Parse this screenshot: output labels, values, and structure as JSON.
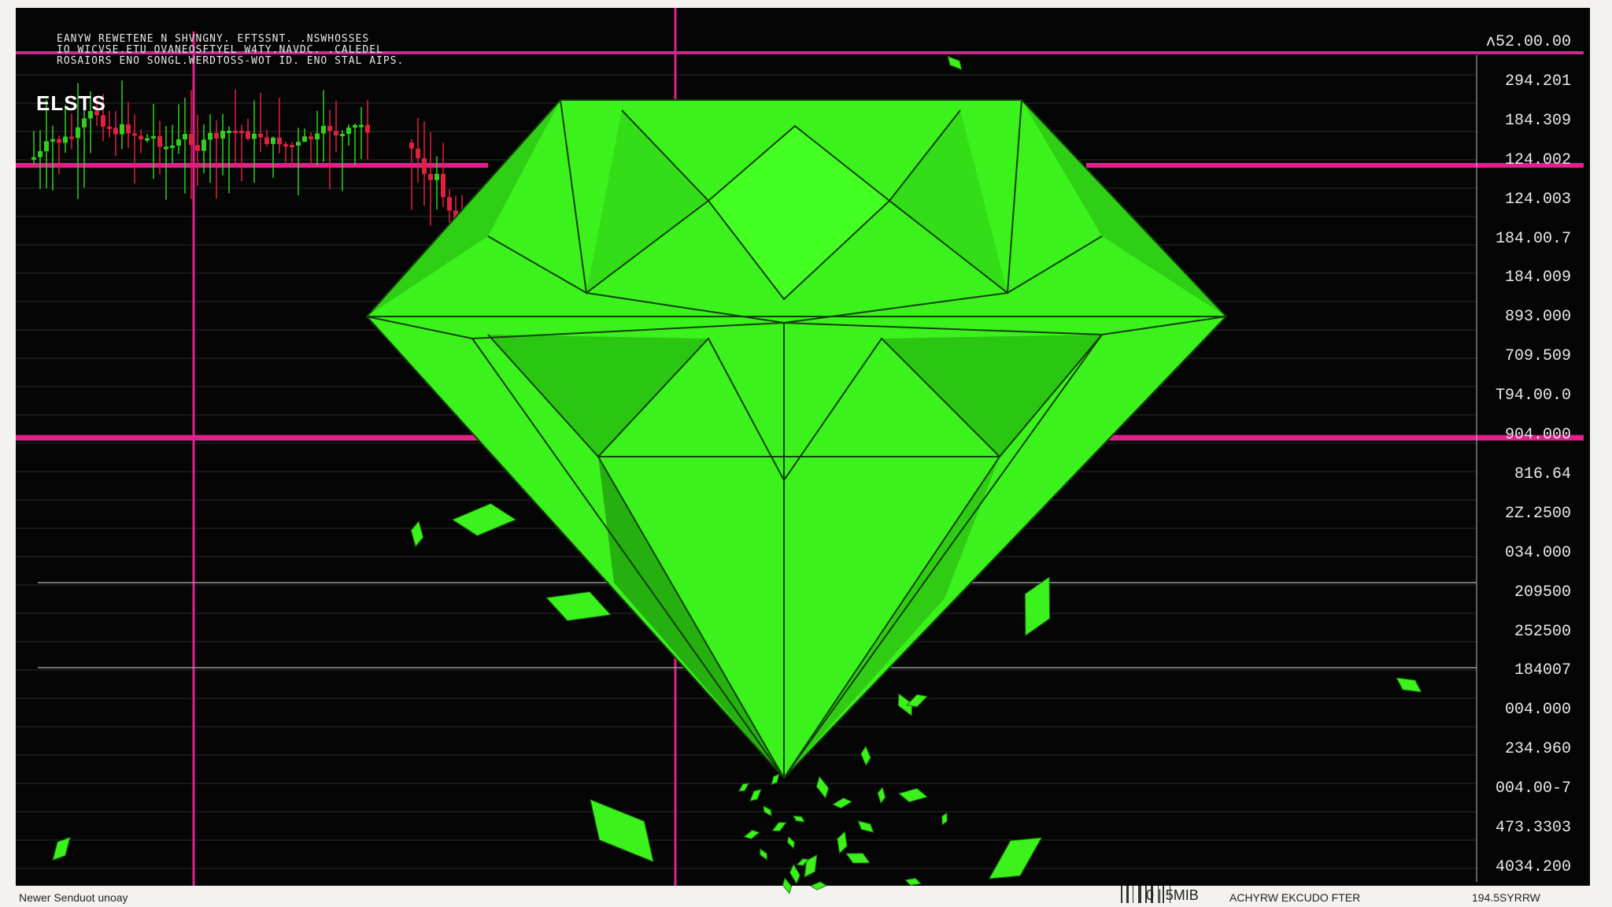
{
  "header": {
    "lines": [
      "EANYW REWETENE N SHVNGNY. EFTSSNT. .NSWHOSSES",
      "IO WICVSE.ETU OVANEOSFTYEL W4TY.NAVDC. .CALEDEL",
      "ROSAIORS ENO SONGL.WERDTOSS-WOT ID. ENO STAL AIPS."
    ],
    "ticker": "ELSTS"
  },
  "price_axis": {
    "labels": [
      "ʌ52.00.00",
      "294.201",
      "184.309",
      "124.002",
      "124.003",
      "184.00.7",
      "184.009",
      "893.000",
      "709.509",
      "T94.00.0",
      "904.000",
      "816.64",
      "2Z.2500",
      "034.000",
      "209500",
      "252500",
      "184007",
      "004.000",
      "234.960",
      "004.00-7",
      "473.3303",
      "4034.200"
    ]
  },
  "footer": {
    "left": "Newer Senduot unoay",
    "barcode_text": "0 | 5MIB",
    "center": "ACHYRW EKCUDO FTER",
    "right": "194.5SYRRW"
  },
  "colors": {
    "background": "#050505",
    "paper": "#f4f2ee",
    "gem": "#3cf21c",
    "gem_dark": "#1a8a0c",
    "magenta": "#e0208c",
    "candle_red": "#e02040",
    "candle_green": "#30d020"
  },
  "icons": {
    "gem": "diamond-icon",
    "shards": "shard-icon"
  }
}
